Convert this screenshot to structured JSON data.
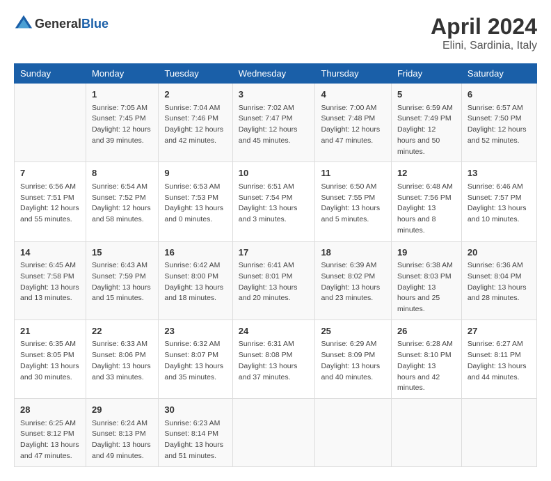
{
  "header": {
    "logo": {
      "text_general": "General",
      "text_blue": "Blue"
    },
    "title": "April 2024",
    "subtitle": "Elini, Sardinia, Italy"
  },
  "weekdays": [
    "Sunday",
    "Monday",
    "Tuesday",
    "Wednesday",
    "Thursday",
    "Friday",
    "Saturday"
  ],
  "weeks": [
    [
      {
        "day": "",
        "sunrise": "",
        "sunset": "",
        "daylight": ""
      },
      {
        "day": "1",
        "sunrise": "Sunrise: 7:05 AM",
        "sunset": "Sunset: 7:45 PM",
        "daylight": "Daylight: 12 hours and 39 minutes."
      },
      {
        "day": "2",
        "sunrise": "Sunrise: 7:04 AM",
        "sunset": "Sunset: 7:46 PM",
        "daylight": "Daylight: 12 hours and 42 minutes."
      },
      {
        "day": "3",
        "sunrise": "Sunrise: 7:02 AM",
        "sunset": "Sunset: 7:47 PM",
        "daylight": "Daylight: 12 hours and 45 minutes."
      },
      {
        "day": "4",
        "sunrise": "Sunrise: 7:00 AM",
        "sunset": "Sunset: 7:48 PM",
        "daylight": "Daylight: 12 hours and 47 minutes."
      },
      {
        "day": "5",
        "sunrise": "Sunrise: 6:59 AM",
        "sunset": "Sunset: 7:49 PM",
        "daylight": "Daylight: 12 hours and 50 minutes."
      },
      {
        "day": "6",
        "sunrise": "Sunrise: 6:57 AM",
        "sunset": "Sunset: 7:50 PM",
        "daylight": "Daylight: 12 hours and 52 minutes."
      }
    ],
    [
      {
        "day": "7",
        "sunrise": "Sunrise: 6:56 AM",
        "sunset": "Sunset: 7:51 PM",
        "daylight": "Daylight: 12 hours and 55 minutes."
      },
      {
        "day": "8",
        "sunrise": "Sunrise: 6:54 AM",
        "sunset": "Sunset: 7:52 PM",
        "daylight": "Daylight: 12 hours and 58 minutes."
      },
      {
        "day": "9",
        "sunrise": "Sunrise: 6:53 AM",
        "sunset": "Sunset: 7:53 PM",
        "daylight": "Daylight: 13 hours and 0 minutes."
      },
      {
        "day": "10",
        "sunrise": "Sunrise: 6:51 AM",
        "sunset": "Sunset: 7:54 PM",
        "daylight": "Daylight: 13 hours and 3 minutes."
      },
      {
        "day": "11",
        "sunrise": "Sunrise: 6:50 AM",
        "sunset": "Sunset: 7:55 PM",
        "daylight": "Daylight: 13 hours and 5 minutes."
      },
      {
        "day": "12",
        "sunrise": "Sunrise: 6:48 AM",
        "sunset": "Sunset: 7:56 PM",
        "daylight": "Daylight: 13 hours and 8 minutes."
      },
      {
        "day": "13",
        "sunrise": "Sunrise: 6:46 AM",
        "sunset": "Sunset: 7:57 PM",
        "daylight": "Daylight: 13 hours and 10 minutes."
      }
    ],
    [
      {
        "day": "14",
        "sunrise": "Sunrise: 6:45 AM",
        "sunset": "Sunset: 7:58 PM",
        "daylight": "Daylight: 13 hours and 13 minutes."
      },
      {
        "day": "15",
        "sunrise": "Sunrise: 6:43 AM",
        "sunset": "Sunset: 7:59 PM",
        "daylight": "Daylight: 13 hours and 15 minutes."
      },
      {
        "day": "16",
        "sunrise": "Sunrise: 6:42 AM",
        "sunset": "Sunset: 8:00 PM",
        "daylight": "Daylight: 13 hours and 18 minutes."
      },
      {
        "day": "17",
        "sunrise": "Sunrise: 6:41 AM",
        "sunset": "Sunset: 8:01 PM",
        "daylight": "Daylight: 13 hours and 20 minutes."
      },
      {
        "day": "18",
        "sunrise": "Sunrise: 6:39 AM",
        "sunset": "Sunset: 8:02 PM",
        "daylight": "Daylight: 13 hours and 23 minutes."
      },
      {
        "day": "19",
        "sunrise": "Sunrise: 6:38 AM",
        "sunset": "Sunset: 8:03 PM",
        "daylight": "Daylight: 13 hours and 25 minutes."
      },
      {
        "day": "20",
        "sunrise": "Sunrise: 6:36 AM",
        "sunset": "Sunset: 8:04 PM",
        "daylight": "Daylight: 13 hours and 28 minutes."
      }
    ],
    [
      {
        "day": "21",
        "sunrise": "Sunrise: 6:35 AM",
        "sunset": "Sunset: 8:05 PM",
        "daylight": "Daylight: 13 hours and 30 minutes."
      },
      {
        "day": "22",
        "sunrise": "Sunrise: 6:33 AM",
        "sunset": "Sunset: 8:06 PM",
        "daylight": "Daylight: 13 hours and 33 minutes."
      },
      {
        "day": "23",
        "sunrise": "Sunrise: 6:32 AM",
        "sunset": "Sunset: 8:07 PM",
        "daylight": "Daylight: 13 hours and 35 minutes."
      },
      {
        "day": "24",
        "sunrise": "Sunrise: 6:31 AM",
        "sunset": "Sunset: 8:08 PM",
        "daylight": "Daylight: 13 hours and 37 minutes."
      },
      {
        "day": "25",
        "sunrise": "Sunrise: 6:29 AM",
        "sunset": "Sunset: 8:09 PM",
        "daylight": "Daylight: 13 hours and 40 minutes."
      },
      {
        "day": "26",
        "sunrise": "Sunrise: 6:28 AM",
        "sunset": "Sunset: 8:10 PM",
        "daylight": "Daylight: 13 hours and 42 minutes."
      },
      {
        "day": "27",
        "sunrise": "Sunrise: 6:27 AM",
        "sunset": "Sunset: 8:11 PM",
        "daylight": "Daylight: 13 hours and 44 minutes."
      }
    ],
    [
      {
        "day": "28",
        "sunrise": "Sunrise: 6:25 AM",
        "sunset": "Sunset: 8:12 PM",
        "daylight": "Daylight: 13 hours and 47 minutes."
      },
      {
        "day": "29",
        "sunrise": "Sunrise: 6:24 AM",
        "sunset": "Sunset: 8:13 PM",
        "daylight": "Daylight: 13 hours and 49 minutes."
      },
      {
        "day": "30",
        "sunrise": "Sunrise: 6:23 AM",
        "sunset": "Sunset: 8:14 PM",
        "daylight": "Daylight: 13 hours and 51 minutes."
      },
      {
        "day": "",
        "sunrise": "",
        "sunset": "",
        "daylight": ""
      },
      {
        "day": "",
        "sunrise": "",
        "sunset": "",
        "daylight": ""
      },
      {
        "day": "",
        "sunrise": "",
        "sunset": "",
        "daylight": ""
      },
      {
        "day": "",
        "sunrise": "",
        "sunset": "",
        "daylight": ""
      }
    ]
  ]
}
